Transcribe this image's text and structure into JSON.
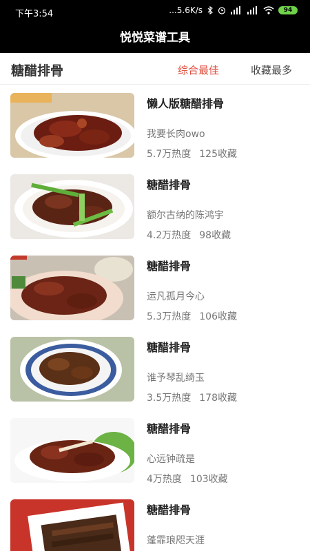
{
  "status": {
    "time": "下午3:54",
    "network": "...5.6K/s",
    "battery": "94"
  },
  "app": {
    "title": "悦悦菜谱工具"
  },
  "filter": {
    "query": "糖醋排骨",
    "sort_active": "综合最佳",
    "sort_other": "收藏最多"
  },
  "recipes": [
    {
      "title": "懒人版糖醋排骨",
      "author": "我要长肉owo",
      "heat": "5.7万热度",
      "favorites": "125收藏"
    },
    {
      "title": "糖醋排骨",
      "author": "额尔古纳的陈鸿宇",
      "heat": "4.2万热度",
      "favorites": "98收藏"
    },
    {
      "title": "糖醋排骨",
      "author": "运凡孤月今心",
      "heat": "5.3万热度",
      "favorites": "106收藏"
    },
    {
      "title": "糖醋排骨",
      "author": "谁予琴乱绮玉",
      "heat": "3.5万热度",
      "favorites": "178收藏"
    },
    {
      "title": "糖醋排骨",
      "author": "心远钟疏是",
      "heat": "4万热度",
      "favorites": "103收藏"
    },
    {
      "title": "糖醋排骨",
      "author": "蓬霏琅咫天涯",
      "heat": "",
      "favorites": ""
    }
  ],
  "colors": {
    "accent": "#e04b3b",
    "header_bg": "#000000",
    "text_secondary": "#777777"
  }
}
